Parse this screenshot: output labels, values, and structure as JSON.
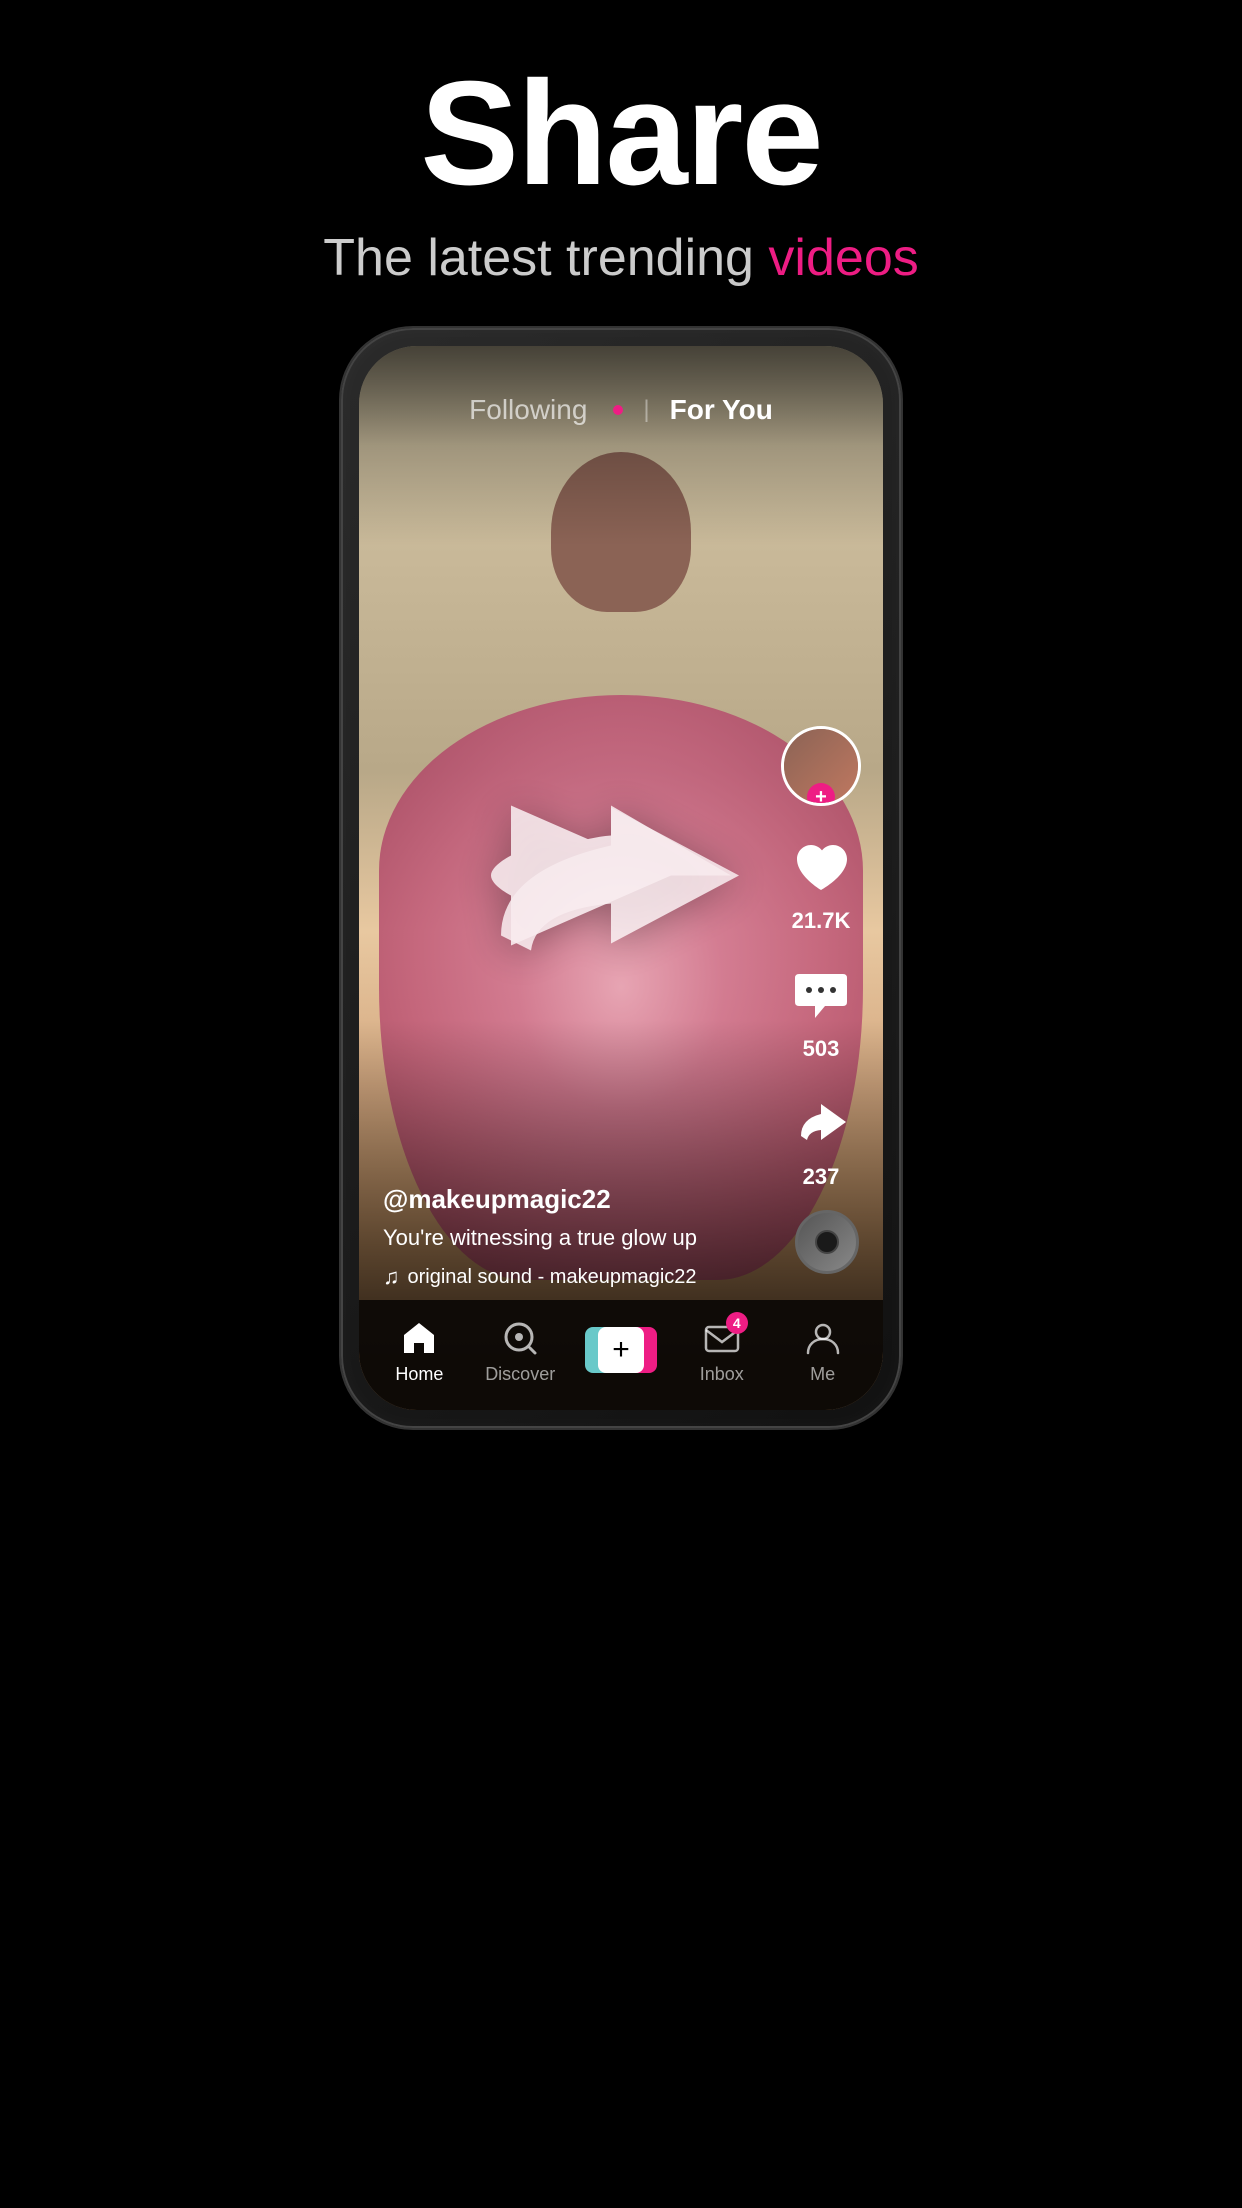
{
  "hero": {
    "title": "Share",
    "subtitle_start": "The latest trending ",
    "subtitle_highlight": "videos"
  },
  "phone": {
    "nav": {
      "following_label": "Following",
      "for_you_label": "For You"
    },
    "video": {
      "username": "@makeupmagic22",
      "caption": "You're witnessing a true glow up",
      "sound": "original sound - makeupmagic22"
    },
    "actions": {
      "likes": "21.7K",
      "comments": "503",
      "shares": "237"
    },
    "bottom_nav": {
      "home": "Home",
      "discover": "Discover",
      "inbox": "Inbox",
      "inbox_badge": "4",
      "me": "Me"
    }
  }
}
